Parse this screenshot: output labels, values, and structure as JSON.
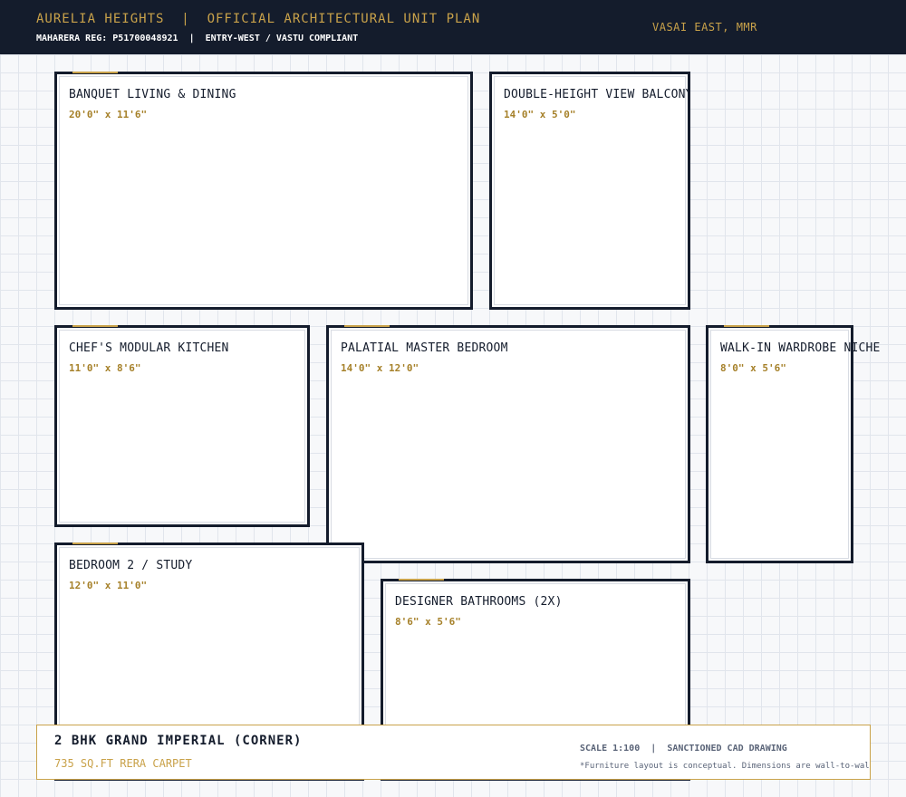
{
  "header": {
    "title": "AURELIA HEIGHTS  |  OFFICIAL ARCHITECTURAL UNIT PLAN",
    "subtitle": "MAHARERA REG: P51700048921  |  ENTRY-WEST / VASTU COMPLIANT",
    "location": "VASAI EAST, MMR"
  },
  "rooms": {
    "living": {
      "name": "BANQUET LIVING & DINING",
      "dimensions": "20'0\" x 11'6\""
    },
    "balcony": {
      "name": "DOUBLE-HEIGHT VIEW BALCONY",
      "dimensions": "14'0\" x 5'0\""
    },
    "kitchen": {
      "name": "CHEF'S MODULAR KITCHEN",
      "dimensions": "11'0\" x 8'6\""
    },
    "master": {
      "name": "PALATIAL MASTER BEDROOM",
      "dimensions": "14'0\" x 12'0\""
    },
    "wardrobe": {
      "name": "WALK-IN WARDROBE NICHE",
      "dimensions": "8'0\" x 5'6\""
    },
    "bedroom2": {
      "name": "BEDROOM 2 / STUDY",
      "dimensions": "12'0\" x 11'0\""
    },
    "bathrooms": {
      "name": "DESIGNER BATHROOMS (2X)",
      "dimensions": "8'6\" x 5'6\""
    }
  },
  "footer": {
    "unit_type": "2 BHK GRAND IMPERIAL (CORNER)",
    "carpet_area": "735 SQ.FT RERA CARPET",
    "scale": "SCALE 1:100  |  SANCTIONED CAD DRAWING",
    "note": "*Furniture layout is conceptual. Dimensions are wall-to-wall."
  },
  "colors": {
    "navy": "#141c2c",
    "gold": "#c9a24a",
    "grid": "#e1e5ec"
  }
}
